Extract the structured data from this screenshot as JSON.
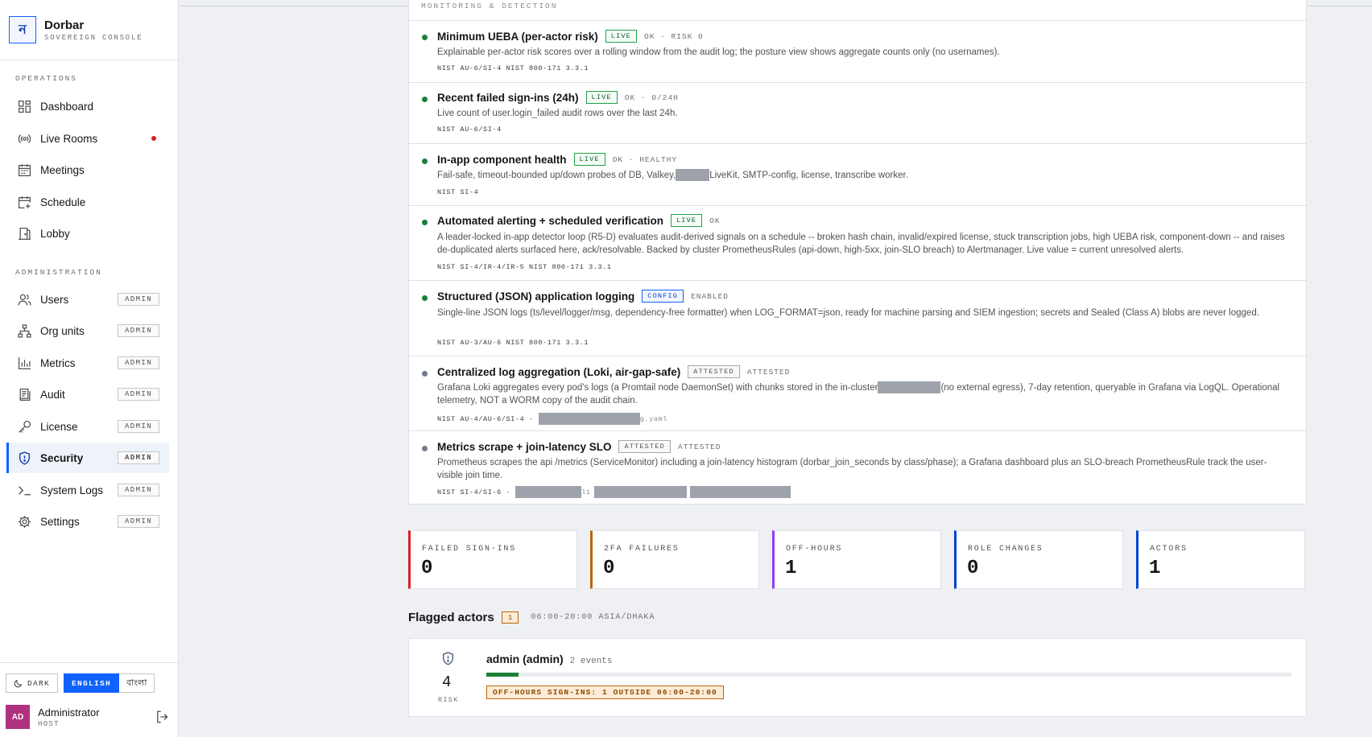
{
  "brand": {
    "name": "Dorbar",
    "subtitle": "SOVEREIGN CONSOLE",
    "logo_glyph": "ন"
  },
  "sidebar": {
    "operations_label": "OPERATIONS",
    "administration_label": "ADMINISTRATION",
    "operations": [
      {
        "label": "Dashboard",
        "icon": "grid-icon"
      },
      {
        "label": "Live Rooms",
        "icon": "broadcast-icon",
        "live_indicator": true
      },
      {
        "label": "Meetings",
        "icon": "calendar-icon"
      },
      {
        "label": "Schedule",
        "icon": "calendar-add-icon"
      },
      {
        "label": "Lobby",
        "icon": "door-icon"
      }
    ],
    "administration": [
      {
        "label": "Users",
        "icon": "users-icon",
        "badge": "ADMIN"
      },
      {
        "label": "Org units",
        "icon": "tree-icon",
        "badge": "ADMIN"
      },
      {
        "label": "Metrics",
        "icon": "bar-chart-icon",
        "badge": "ADMIN"
      },
      {
        "label": "Audit",
        "icon": "audit-icon",
        "badge": "ADMIN"
      },
      {
        "label": "License",
        "icon": "key-icon",
        "badge": "ADMIN"
      },
      {
        "label": "Security",
        "icon": "shield-icon",
        "badge": "ADMIN",
        "active": true
      },
      {
        "label": "System Logs",
        "icon": "terminal-icon",
        "badge": "ADMIN"
      },
      {
        "label": "Settings",
        "icon": "gear-icon",
        "badge": "ADMIN"
      }
    ],
    "theme_toggle": "DARK",
    "lang_english": "ENGLISH",
    "lang_bangla": "বাংলা",
    "user": {
      "initials": "AD",
      "name": "Administrator",
      "role": "HOST"
    }
  },
  "controls": {
    "section_label": "MONITORING & DETECTION",
    "items": [
      {
        "title": "Minimum UEBA (per-actor risk)",
        "tag": "LIVE",
        "status": "OK · RISK 0",
        "state": "green",
        "desc": "Explainable per-actor risk scores over a rolling window from the audit log; the posture view shows aggregate counts only (no usernames).",
        "ref": "NIST AU-6/SI-4 NIST 800-171 3.3.1"
      },
      {
        "title": "Recent failed sign-ins (24h)",
        "tag": "LIVE",
        "status": "OK · 0/24H",
        "state": "green",
        "desc": "Live count of user.login_failed audit rows over the last 24h.",
        "ref": "NIST AU-6/SI-4"
      },
      {
        "title": "In-app component health",
        "tag": "LIVE",
        "status": "OK · HEALTHY",
        "state": "green",
        "desc_pre": "Fail-safe, timeout-bounded up/down probes of DB, Valkey,",
        "desc_post": "LiveKit, SMTP-config, license, transcribe worker.",
        "ref": "NIST SI-4"
      },
      {
        "title": "Automated alerting + scheduled verification",
        "tag": "LIVE",
        "status": "OK",
        "state": "green",
        "desc": "A leader-locked in-app detector loop (R5-D) evaluates audit-derived signals on a schedule -- broken hash chain, invalid/expired license, stuck transcription jobs, high UEBA risk, component-down -- and raises de-duplicated alerts surfaced here, ack/resolvable. Backed by cluster PrometheusRules (api-down, high-5xx, join-SLO breach) to Alertmanager. Live value = current unresolved alerts.",
        "ref": "NIST SI-4/IR-4/IR-5 NIST 800-171 3.3.1"
      },
      {
        "title": "Structured (JSON) application logging",
        "tag": "CONFIG",
        "status": "ENABLED",
        "state": "green",
        "desc": "Single-line JSON logs (ts/level/logger/msg, dependency-free formatter) when LOG_FORMAT=json, ready for machine parsing and SIEM ingestion; secrets and Sealed (Class A) blobs are never logged.",
        "ref": "NIST AU-3/AU-6 NIST 800-171 3.3.1"
      },
      {
        "title": "Centralized log aggregation (Loki, air-gap-safe)",
        "tag": "ATTESTED",
        "status": "ATTESTED",
        "state": "grey",
        "desc_pre": "Grafana Loki aggregates every pod's logs (a Promtail node DaemonSet) with chunks stored in the in-cluster",
        "desc_post": "(no external egress), 7-day retention, queryable in Grafana via LogQL. Operational telemetry, NOT a WORM copy of the audit chain.",
        "ref": "NIST AU-4/AU-6/SI-4 ·",
        "ref_tail": "g.yaml"
      },
      {
        "title": "Metrics scrape + join-latency SLO",
        "tag": "ATTESTED",
        "status": "ATTESTED",
        "state": "grey",
        "desc": "Prometheus scrapes the api /metrics (ServiceMonitor) including a join-latency histogram (dorbar_join_seconds by class/phase); a Grafana dashboard plus an SLO-breach PrometheusRule track the user-visible join time.",
        "ref": "NIST SI-4/SI-6 ·",
        "ref_tail": "l1"
      }
    ]
  },
  "stats": [
    {
      "label": "FAILED SIGN-INS",
      "value": "0",
      "color": "#da1e28"
    },
    {
      "label": "2FA FAILURES",
      "value": "0",
      "color": "#b8650a"
    },
    {
      "label": "OFF-HOURS",
      "value": "1",
      "color": "#8a3ffc"
    },
    {
      "label": "ROLE CHANGES",
      "value": "0",
      "color": "#0043ce"
    },
    {
      "label": "ACTORS",
      "value": "1",
      "color": "#0043ce"
    }
  ],
  "flagged": {
    "title": "Flagged actors",
    "count": "1",
    "window": "06:00-20:00 ASIA/DHAKA",
    "actors": [
      {
        "risk": "4",
        "risk_label": "RISK",
        "name": "admin (admin)",
        "events": "2 events",
        "risk_fraction": 0.04,
        "reason": "OFF-HOURS SIGN-INS: 1 OUTSIDE 06:00-20:00"
      }
    ]
  }
}
